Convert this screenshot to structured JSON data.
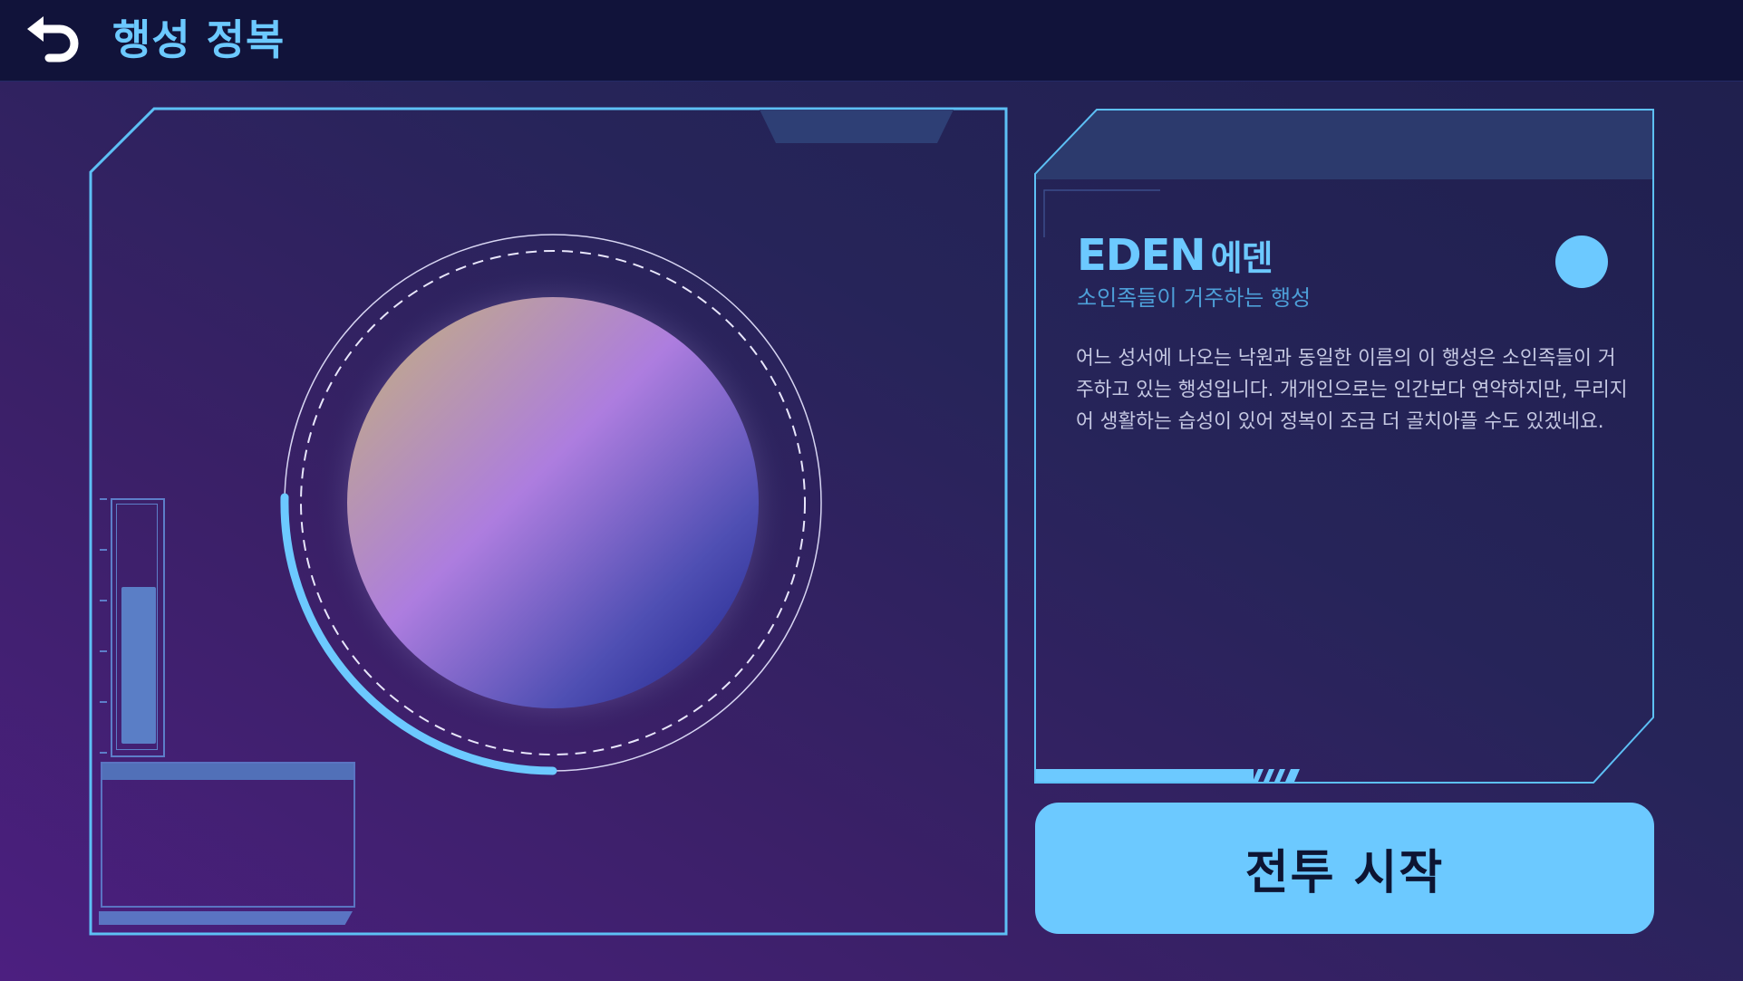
{
  "header": {
    "back_icon": "back-arrow-icon",
    "title": "행성 정복"
  },
  "planet": {
    "name_en": "EDEN",
    "name_kr": "에덴",
    "subtitle": "소인족들이 거주하는 행성",
    "description": "어느 성서에 나오는 낙원과 동일한 이름의 이 행성은 소인족들이 거주하고 있는 행성입니다. 개개인으로는 인간보다 연약하지만, 무리지어 생활하는 습성이 있어 정복이 조금 더 골치아플 수도 있겠네요.",
    "status_color": "#6cc9ff",
    "orbit_progress": 0.25
  },
  "gauge": {
    "fill_level": 0.67
  },
  "action": {
    "battle_label": "전투 시작"
  },
  "theme": {
    "accent": "#6cc9ff",
    "frame_line": "#5dc0f5",
    "topbar_bg": "#11133a"
  }
}
